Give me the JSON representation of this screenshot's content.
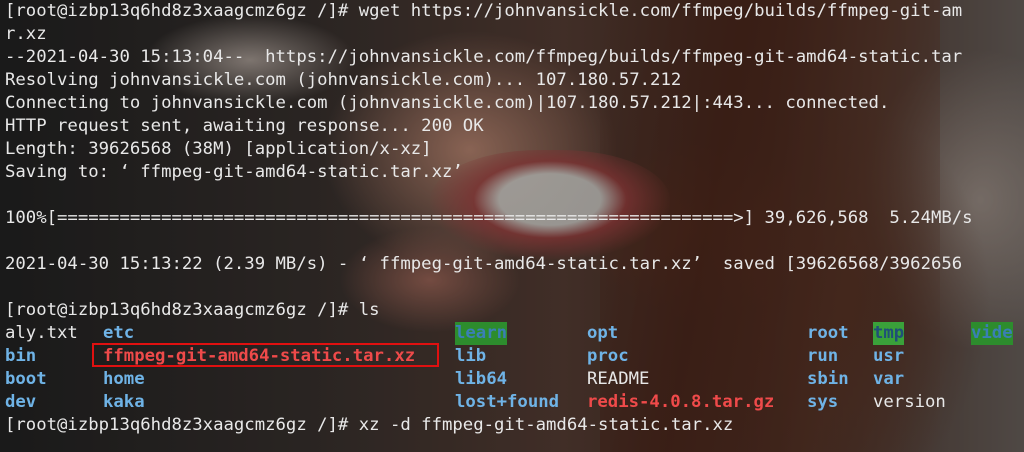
{
  "terminal": {
    "lines": {
      "l0": "[root@izbp13q6hd8z3xaagcmz6gz /]# wget https://johnvansickle.com/ffmpeg/builds/ffmpeg-git-am",
      "l1": "r.xz",
      "l2": "--2021-04-30 15:13:04--  https://johnvansickle.com/ffmpeg/builds/ffmpeg-git-amd64-static.tar",
      "l3": "Resolving johnvansickle.com (johnvansickle.com)... 107.180.57.212",
      "l4": "Connecting to johnvansickle.com (johnvansickle.com)|107.180.57.212|:443... connected.",
      "l5": "HTTP request sent, awaiting response... 200 OK",
      "l6": "Length: 39626568 (38M) [application/x-xz]",
      "l7": "Saving to: ‘ ffmpeg-git-amd64-static.tar.xz’",
      "l9": "100%[=================================================================>] 39,626,568  5.24MB/s",
      "l11": "2021-04-30 15:13:22 (2.39 MB/s) - ‘ ffmpeg-git-amd64-static.tar.xz’  saved [39626568/3962656",
      "l13": "[root@izbp13q6hd8z3xaagcmz6gz /]# ls",
      "l17": "[root@izbp13q6hd8z3xaagcmz6gz /]# xz -d ffmpeg-git-amd64-static.tar.xz"
    },
    "ls": {
      "aly": "aly.txt",
      "etc": "etc",
      "learn": "learn",
      "opt": "opt",
      "root": "root",
      "tmp": "tmp",
      "vide": "vide",
      "bin": "bin",
      "ffmpeg": "ffmpeg-git-amd64-static.tar.xz",
      "lib": "lib",
      "proc": "proc",
      "run": "run",
      "usr": "usr",
      "boot": "boot",
      "home": "home",
      "lib64": "lib64",
      "readme": "README",
      "sbin": "sbin",
      "var": "var",
      "dev": "dev",
      "kaka": "kaka",
      "lostfound": "lost+found",
      "redis": "redis-4.0.8.tar.gz",
      "sys": "sys",
      "version": "version"
    },
    "colors": {
      "directory": "#6fb3e6",
      "archive": "#ef4a4a",
      "sticky_bg": "#2d8c2d",
      "highlight_box": "#e01010"
    }
  }
}
